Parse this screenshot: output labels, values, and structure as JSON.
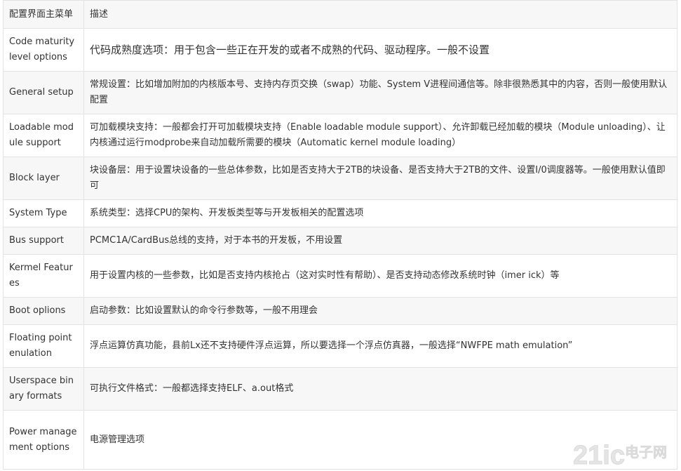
{
  "header": {
    "col1": "配置界面主菜单",
    "col2": "描述"
  },
  "rows": [
    {
      "menu": "Code maturity level options",
      "desc": "代码成熟度选项：用于包含一些正在开发的或者不成熟的代码、驱动程序。一般不设置",
      "emph": true
    },
    {
      "menu": "General setup",
      "desc": "常规设置：比如增加附加的内核版本号、支持内存页交换（swap）功能、System V进程间通信等。除非很熟悉其中的内容，否则一般使用默认配置"
    },
    {
      "menu": "Loadable module support",
      "desc": "可加载模块支持：一般都会打开可加载模块支持（Enable loadable module support）、允许卸载已经加载的模块（Module unloading）、让内核通过运行modprobe来自动加载所需要的模块（Automatic kernel module loading）"
    },
    {
      "menu": "Block layer",
      "desc": "块设备层：用于设置块设备的一些总体参数，比如是否支持大于2TB的块设备、是否支持大于2TB的文件、设置I/0调度器等。一般使用默认值即可"
    },
    {
      "menu": "System Type",
      "desc": "系统类型：选择CPU的架构、开发板类型等与开发板相关的配置选项"
    },
    {
      "menu": "Bus support",
      "desc": "PCMC1A/CardBus总线的支持，对于本书的开发板，不用设置"
    },
    {
      "menu": "Kermel Features",
      "desc": "用于设置内核的一些参数，比如是否支持内核抢占（这对实时性有帮助）、是否支持动态修改系统时钟（imer ick）等"
    },
    {
      "menu": "Boot oplions",
      "desc": "启动参数：比如设置默认的命令行参数等，一般不用理会"
    },
    {
      "menu": "Floating point enulation",
      "desc": "浮点运算仿真功能，县前Lx还不支持硬件浮点运算，所以要选择一个浮点仿真器，一般选择“NWFPE math emulation”"
    },
    {
      "menu": "Userspace binary formats",
      "desc": "可执行文件格式：一般都选择支持ELF、a.out格式"
    },
    {
      "menu": "Power management options",
      "desc": "电源管理选项"
    }
  ],
  "watermark": {
    "logo": "21ic",
    "text": "电子网"
  }
}
